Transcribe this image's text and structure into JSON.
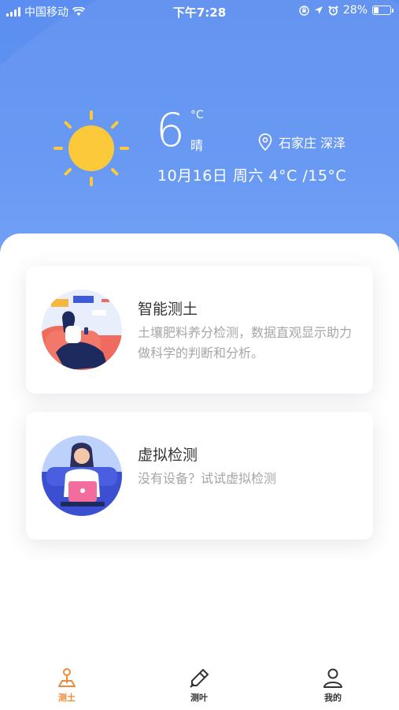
{
  "status_bar": {
    "carrier": "中国移动",
    "time": "下午7:28",
    "battery": "28%",
    "battery_level": 0.28,
    "icons": [
      "signal-icon",
      "wifi-icon",
      "orientation-lock-icon",
      "location-arrow-icon",
      "alarm-icon",
      "battery-icon"
    ]
  },
  "weather": {
    "temperature": "6",
    "unit": "°C",
    "condition": "晴",
    "location": "石家庄 深泽",
    "date_line": "10月16日 周六 4°C /15°C",
    "icon": "sun-icon"
  },
  "cards": [
    {
      "title": "智能测土",
      "description": "土壤肥料养分检测，数据直观显示助力做科学的判断和分析。",
      "illustration": "woman-on-sofa-with-phone"
    },
    {
      "title": "虚拟检测",
      "description": "没有设备？试试虚拟检测",
      "illustration": "woman-with-laptop"
    }
  ],
  "tabs": [
    {
      "label": "测土",
      "icon": "soil-probe-icon",
      "active": true
    },
    {
      "label": "测叶",
      "icon": "pen-probe-icon",
      "active": false
    },
    {
      "label": "我的",
      "icon": "user-icon",
      "active": false
    }
  ],
  "colors": {
    "header_blue": "#5b8ef0",
    "sun_yellow": "#fcc93a",
    "active_tab": "#f08a36",
    "text_dark": "#333333",
    "text_muted": "#a6a6a6"
  }
}
